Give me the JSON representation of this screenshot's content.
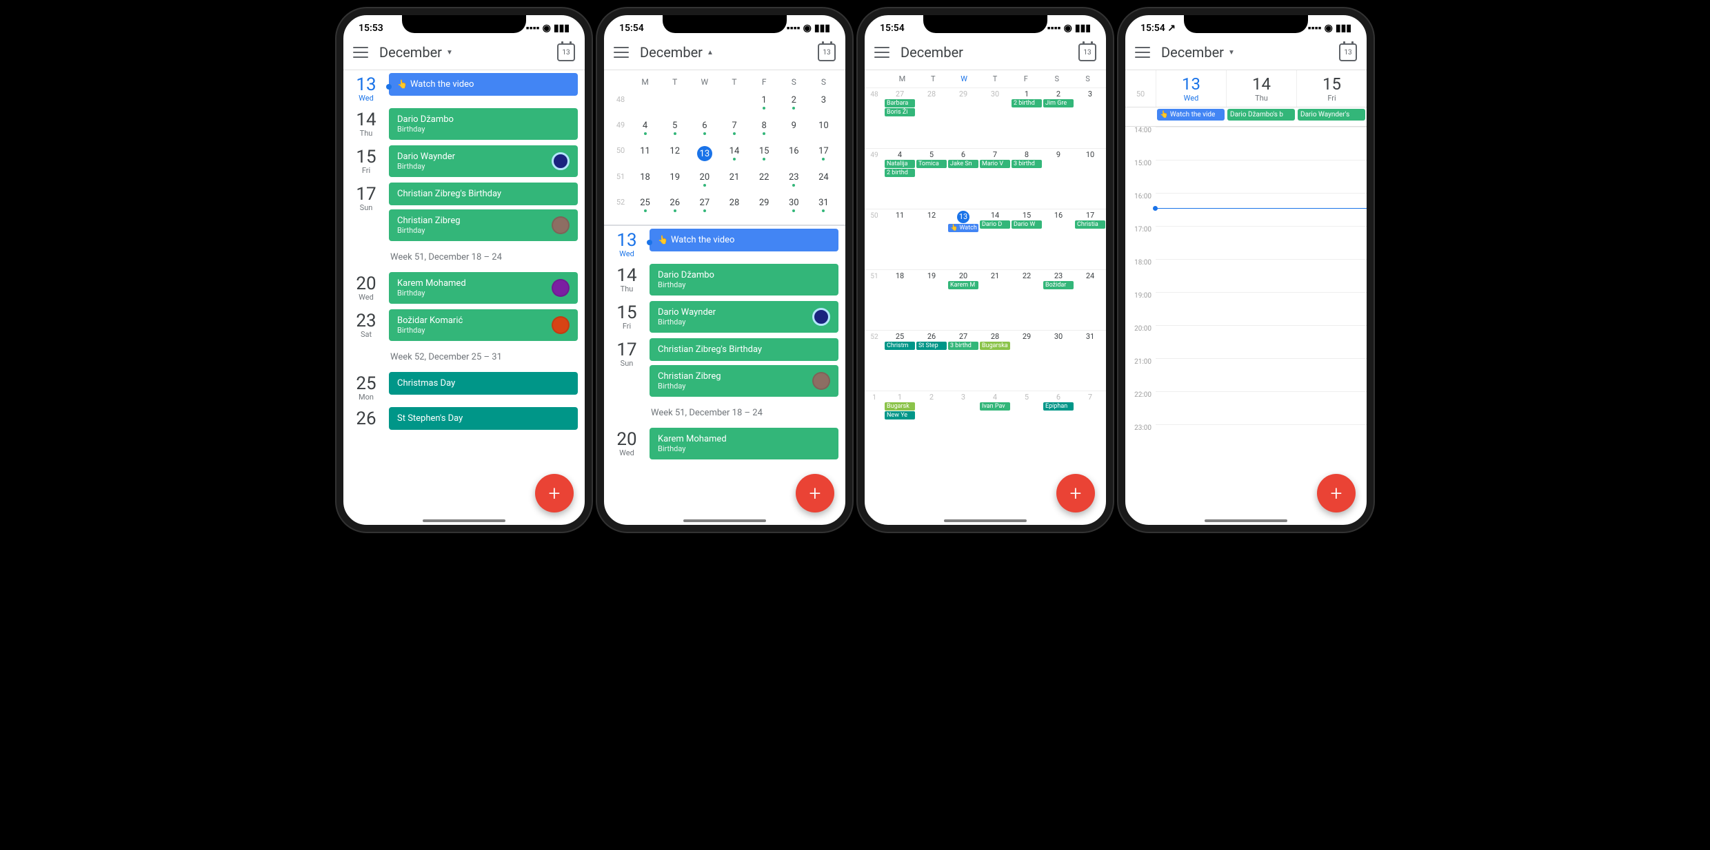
{
  "status": {
    "t1": "15:53",
    "t2": "15:54",
    "t3": "15:54",
    "t4": "15:54",
    "loc": "↗"
  },
  "header": {
    "month": "December",
    "today": "13"
  },
  "days_short": [
    "M",
    "T",
    "W",
    "T",
    "F",
    "S",
    "S"
  ],
  "sched": {
    "d13": {
      "num": "13",
      "dow": "Wed",
      "ev": "Watch the video"
    },
    "d14": {
      "num": "14",
      "dow": "Thu",
      "name": "Dario Džambo",
      "sub": "Birthday"
    },
    "d15": {
      "num": "15",
      "dow": "Fri",
      "name": "Dario Waynder",
      "sub": "Birthday"
    },
    "d17": {
      "num": "17",
      "dow": "Sun",
      "e1": "Christian Zibreg's Birthday",
      "e2": "Christian Zibreg",
      "sub": "Birthday"
    },
    "wk51": "Week 51, December 18 – 24",
    "d20": {
      "num": "20",
      "dow": "Wed",
      "name": "Karem Mohamed",
      "sub": "Birthday"
    },
    "d23": {
      "num": "23",
      "dow": "Sat",
      "name": "Božidar Komarić",
      "sub": "Birthday"
    },
    "wk52": "Week 52, December 25 – 31",
    "d25": {
      "num": "25",
      "dow": "Mon",
      "name": "Christmas Day"
    },
    "d26": {
      "num": "26",
      "name": "St Stephen's Day"
    }
  },
  "minimonth": {
    "weeks": [
      {
        "wn": "48",
        "d": [
          "",
          "",
          "",
          "",
          "1",
          "2",
          "3"
        ],
        "dots": [
          0,
          0,
          0,
          0,
          1,
          1,
          0
        ]
      },
      {
        "wn": "49",
        "d": [
          "4",
          "5",
          "6",
          "7",
          "8",
          "9",
          "10"
        ],
        "dots": [
          1,
          1,
          1,
          1,
          1,
          0,
          0
        ]
      },
      {
        "wn": "50",
        "d": [
          "11",
          "12",
          "13",
          "14",
          "15",
          "16",
          "17"
        ],
        "dots": [
          0,
          0,
          0,
          1,
          1,
          0,
          1
        ]
      },
      {
        "wn": "51",
        "d": [
          "18",
          "19",
          "20",
          "21",
          "22",
          "23",
          "24"
        ],
        "dots": [
          0,
          0,
          1,
          0,
          0,
          1,
          0
        ]
      },
      {
        "wn": "52",
        "d": [
          "25",
          "26",
          "27",
          "28",
          "29",
          "30",
          "31"
        ],
        "dots": [
          1,
          1,
          1,
          0,
          0,
          1,
          1
        ]
      }
    ]
  },
  "month": {
    "w48": {
      "wn": "48",
      "days": [
        "27",
        "28",
        "29",
        "30",
        "1",
        "2",
        "3"
      ],
      "chips": [
        [
          "Barbara",
          "Boris Ži"
        ],
        [],
        [],
        [],
        [
          "2 birthd"
        ],
        [
          "Jim Gre"
        ],
        []
      ]
    },
    "w49": {
      "wn": "49",
      "days": [
        "4",
        "5",
        "6",
        "7",
        "8",
        "9",
        "10"
      ],
      "chips": [
        [
          "Natalija",
          "2 birthd"
        ],
        [
          "Tomica"
        ],
        [
          "Jake Sn"
        ],
        [
          "Mario V"
        ],
        [
          "3 birthd"
        ],
        [],
        []
      ]
    },
    "w50": {
      "wn": "50",
      "days": [
        "11",
        "12",
        "13",
        "14",
        "15",
        "16",
        "17"
      ],
      "chips": [
        [],
        [],
        [
          "Watch"
        ],
        [
          "Dario D"
        ],
        [
          "Dario W"
        ],
        [],
        [
          "Christia"
        ]
      ]
    },
    "w51": {
      "wn": "51",
      "days": [
        "18",
        "19",
        "20",
        "21",
        "22",
        "23",
        "24"
      ],
      "chips": [
        [],
        [],
        [
          "Karem M"
        ],
        [],
        [],
        [
          "Božidar"
        ],
        []
      ]
    },
    "w52": {
      "wn": "52",
      "days": [
        "25",
        "26",
        "27",
        "28",
        "29",
        "30",
        "31"
      ],
      "chips": [
        [
          "Christm"
        ],
        [
          "St Step"
        ],
        [
          "3 birthd"
        ],
        [
          "Bugarska"
        ],
        [],
        [],
        []
      ]
    },
    "w1": {
      "wn": "1",
      "days": [
        "1",
        "2",
        "3",
        "4",
        "5",
        "6",
        "7"
      ],
      "chips": [
        [
          "Bugarsk",
          "New Ye"
        ],
        [],
        [],
        [
          "Ivan Pav"
        ],
        [],
        [
          "Epiphan"
        ],
        []
      ]
    }
  },
  "threeday": {
    "wn": "50",
    "cols": [
      {
        "num": "13",
        "dow": "Wed",
        "today": true,
        "chip": "Watch the vide"
      },
      {
        "num": "14",
        "dow": "Thu",
        "chip": "Dario Džambo's b"
      },
      {
        "num": "15",
        "dow": "Fri",
        "chip": "Dario Waynder's"
      }
    ],
    "hours": [
      "14:00",
      "15:00",
      "16:00",
      "17:00",
      "18:00",
      "19:00",
      "20:00",
      "21:00",
      "22:00",
      "23:00"
    ]
  }
}
